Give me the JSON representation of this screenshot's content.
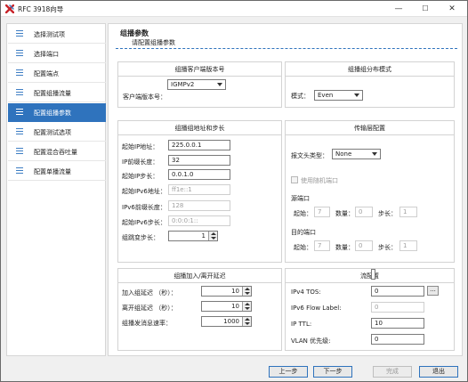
{
  "window": {
    "title": "RFC 3918向导",
    "min": "—",
    "max": "☐",
    "close": "✕"
  },
  "sidebar": {
    "items": [
      {
        "label": "选择测试项"
      },
      {
        "label": "选择端口"
      },
      {
        "label": "配置端点"
      },
      {
        "label": "配置组播流量"
      },
      {
        "label": "配置组播参数",
        "active": true
      },
      {
        "label": "配置测试选项"
      },
      {
        "label": "配置混合吞吐量"
      },
      {
        "label": "配置单播流量"
      }
    ]
  },
  "header": {
    "title": "组播参数",
    "subtitle": "请配置组播参数"
  },
  "client_version": {
    "title": "组播客户端版本号",
    "label": "客户端版本号：",
    "value": "IGMPv2"
  },
  "distribution": {
    "title": "组播组分布模式",
    "label": "模式：",
    "value": "Even"
  },
  "address": {
    "title": "组播组地址和步长",
    "ipv4_start_label": "起始IP地址：",
    "ipv4_start": "225.0.0.1",
    "prefix_label": "IP前缀长度：",
    "prefix": "32",
    "ip_step_label": "起始IP步长：",
    "ip_step": "0.0.1.0",
    "ipv6_start_label": "起始IPv6地址：",
    "ipv6_start": "ff1e::1",
    "ipv6_prefix_label": "IPv6前缀长度：",
    "ipv6_prefix": "128",
    "ipv6_step_label": "起始IPv6步长：",
    "ipv6_step": "0:0:0:1::",
    "group_step_label": "组跳变步长：",
    "group_step": "1"
  },
  "transport": {
    "title": "传输层配置",
    "header_label": "报文头类型：",
    "header_value": "None",
    "random_port_label": "使用随机端口",
    "src_label": "源端口",
    "dst_label": "目的端口",
    "start_label": "起始：",
    "count_label": "数量：",
    "step_label": "步长：",
    "src_start": "7",
    "src_count": "0",
    "src_step": "1",
    "dst_start": "7",
    "dst_count": "0",
    "dst_step": "1"
  },
  "delay": {
    "title": "组播加入/离开延迟",
    "join_label": "加入组延迟 （秒）：",
    "join": "10",
    "leave_label": "离开组延迟 （秒）：",
    "leave": "10",
    "rate_label": "组播发消息速率：",
    "rate": "1000"
  },
  "flow": {
    "title": "流配置",
    "tos_label": "IPv4 TOS:",
    "tos": "0",
    "tos_btn": "...",
    "flow_label_label": "IPv6 Flow Label:",
    "flow_label": "0",
    "ttl_label": "IP TTL:",
    "ttl": "10",
    "vlan_label": "VLAN 优先级:",
    "vlan": "0"
  },
  "footer": {
    "prev": "上一步",
    "next": "下一步",
    "finish": "完成",
    "exit": "退出"
  },
  "colors": {
    "accent": "#2f73bd",
    "icon_red": "#c8242b"
  }
}
